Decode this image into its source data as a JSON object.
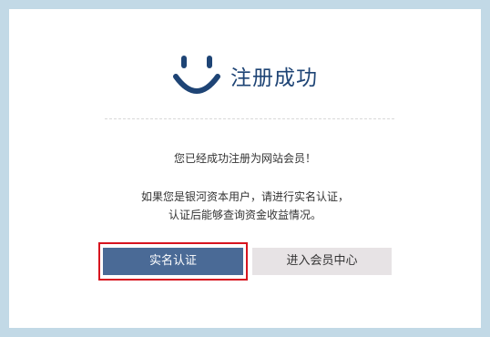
{
  "dialog": {
    "title": "注册成功",
    "success_message": "您已经成功注册为网站会员！",
    "prompt_line1": "如果您是银河资本用户，请进行实名认证，",
    "prompt_line2": "认证后能够查询资金收益情况。"
  },
  "buttons": {
    "verify_label": "实名认证",
    "member_center_label": "进入会员中心"
  },
  "colors": {
    "accent": "#1e4475",
    "frame": "#c2d9e6",
    "primary_button": "#4a6a96",
    "secondary_button": "#e7e3e5",
    "highlight": "#d7141f"
  }
}
